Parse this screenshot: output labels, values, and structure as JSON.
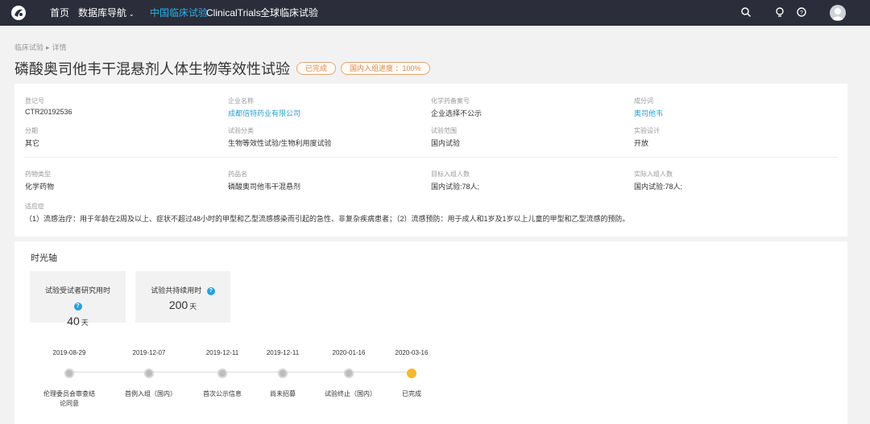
{
  "nav": {
    "items": [
      {
        "label": "首页"
      },
      {
        "label": "数据库导航"
      },
      {
        "label": "中国临床试验"
      },
      {
        "label": "ClinicalTrials"
      },
      {
        "label": "全球临床试验"
      }
    ],
    "active_color": "#2ab0e8"
  },
  "breadcrumb": [
    "临床试验",
    "详情"
  ],
  "title": "磷酸奥司他韦干混悬剂人体生物等效性试验",
  "badges": {
    "status": "已完成",
    "progress": "国内入组进度 ：100%"
  },
  "info": {
    "reg_no": {
      "label": "登记号",
      "value": "CTR20192536"
    },
    "company": {
      "label": "企业名称",
      "value": "成都倍特药业有限公司"
    },
    "drug_code": {
      "label": "化学药备案号",
      "value": "企业选择不公示"
    },
    "ingredient": {
      "label": "成分词",
      "value": "奥司他韦"
    },
    "phase": {
      "label": "分期",
      "value": "其它"
    },
    "trial_type": {
      "label": "试验分类",
      "value": "生物等效性试验/生物利用度试验"
    },
    "scope": {
      "label": "试验范围",
      "value": "国内试验"
    },
    "design": {
      "label": "实验设计",
      "value": "开放"
    },
    "drug_type": {
      "label": "药物类型",
      "value": "化学药物"
    },
    "drug_name": {
      "label": "药品名",
      "value": "磷酸奥司他韦干混悬剂"
    },
    "target_enroll": {
      "label": "目标入组人数",
      "value": "国内试验:78人;"
    },
    "actual_enroll": {
      "label": "实际入组人数",
      "value": "国内试验:78人;"
    },
    "indication": {
      "label": "适应症",
      "value": "（1）流感治疗：用于年龄在2周及以上、症状不超过48小时的甲型和乙型流感感染而引起的急性、非复杂疾病患者；（2）流感预防：用于成人和1岁及1岁以上儿童的甲型和乙型流感的预防。"
    }
  },
  "timeline": {
    "heading": "时光轴",
    "stats": [
      {
        "label": "试验受试者研究用时",
        "value": "40",
        "unit": "天"
      },
      {
        "label": "试验共持续用时",
        "value": "200",
        "unit": "天"
      }
    ],
    "nodes": [
      {
        "date": "2019-08-29",
        "label": "伦理委员会审查结论同意",
        "done": false
      },
      {
        "date": "2019-12-07",
        "label": "首例入组（国内）",
        "done": false
      },
      {
        "date": "2019-12-11",
        "label": "首次公示信息",
        "done": false
      },
      {
        "date": "2019-12-11",
        "label": "尚未招募",
        "done": false
      },
      {
        "date": "2020-01-16",
        "label": "试验终止（国内）",
        "done": false
      },
      {
        "date": "2020-03-16",
        "label": "已完成",
        "done": true
      }
    ]
  }
}
